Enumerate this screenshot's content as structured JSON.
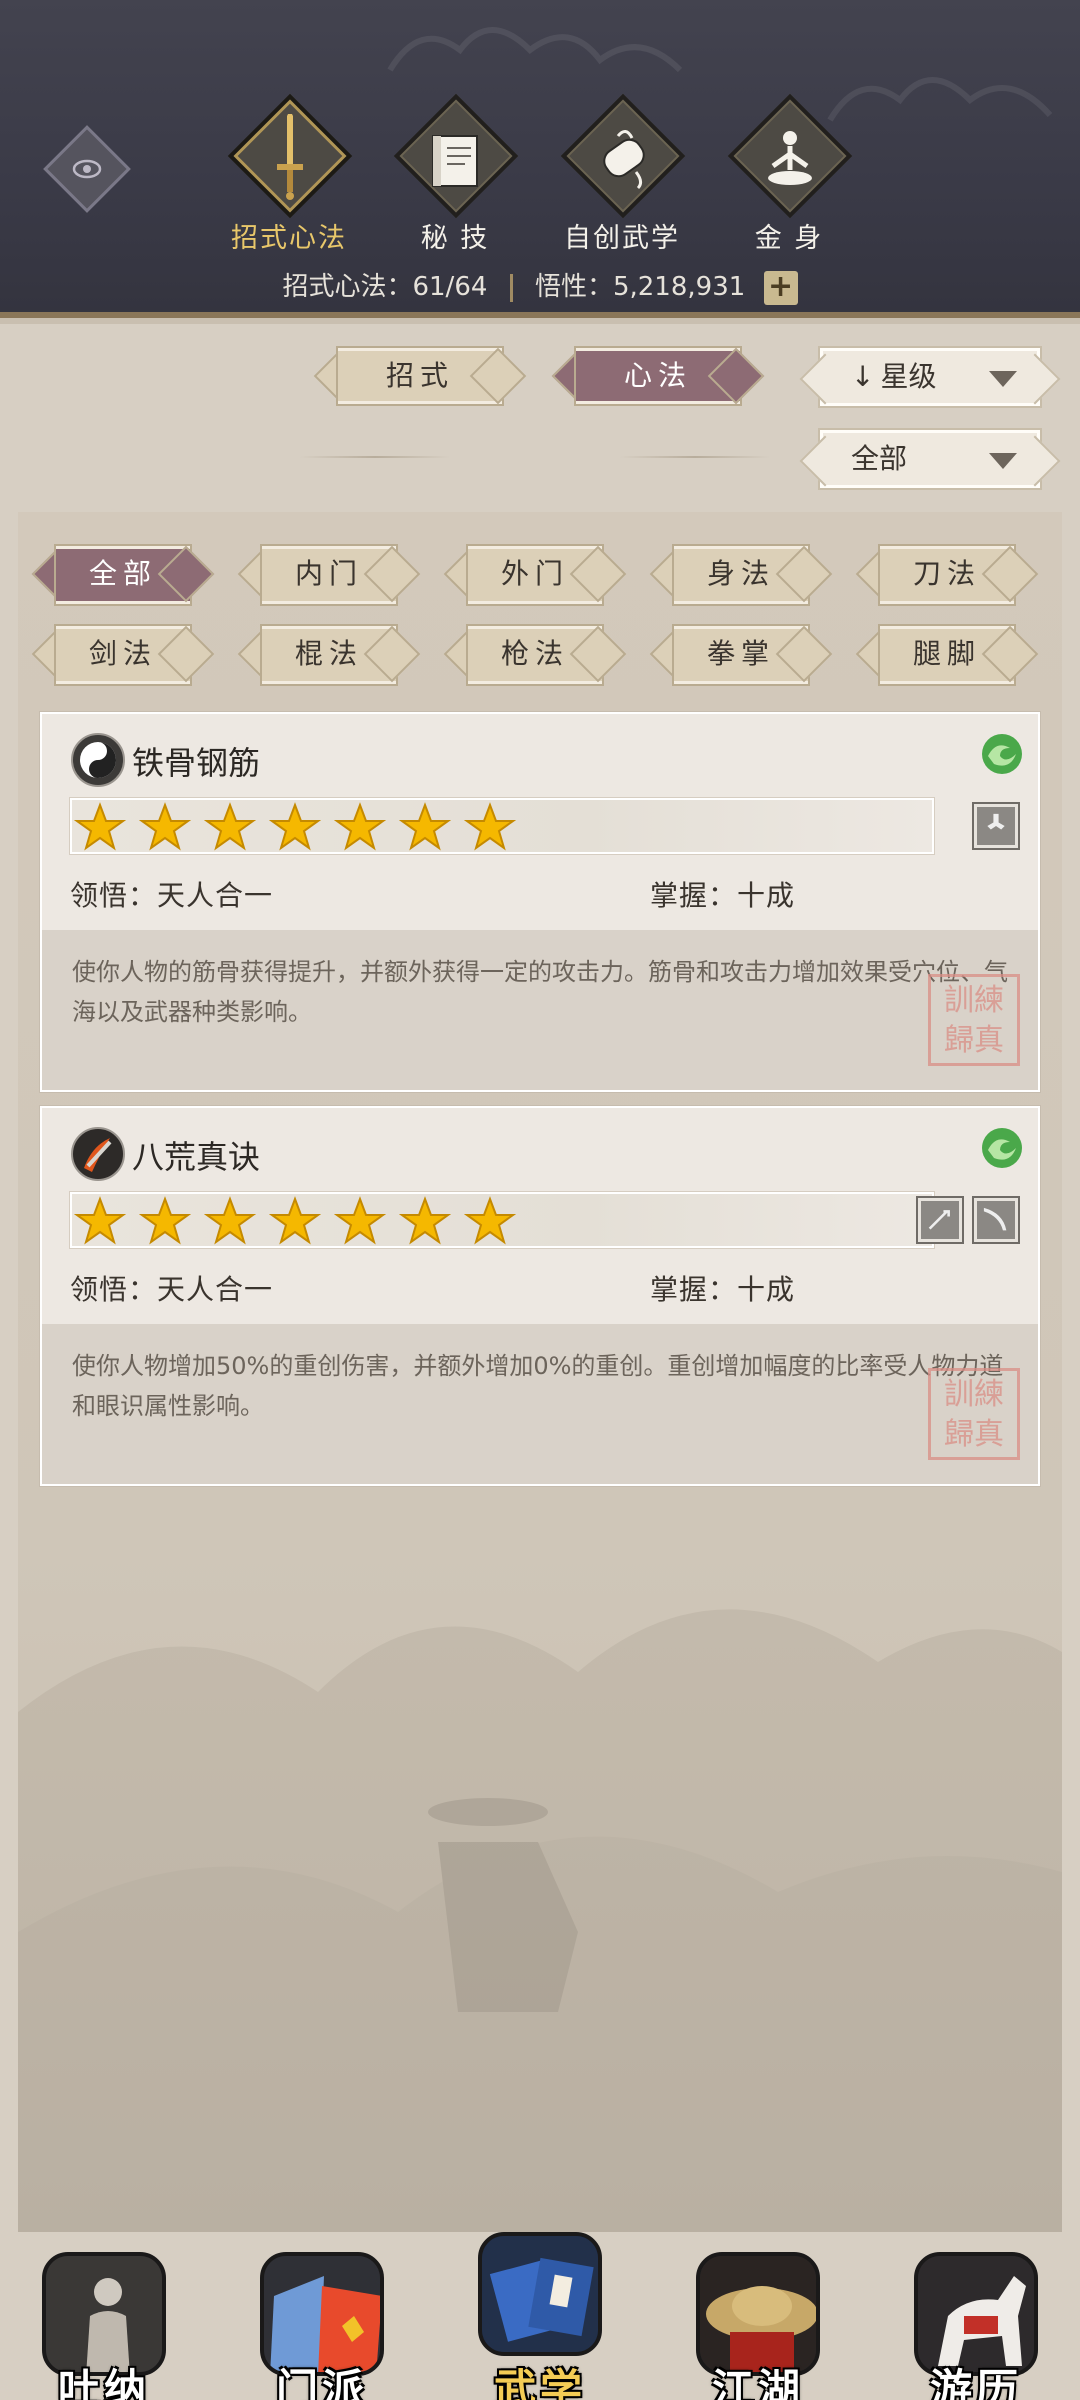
{
  "header": {
    "tabs": [
      {
        "label": "招式心法",
        "icon": "sword-icon",
        "active": true
      },
      {
        "label": "秘 技",
        "icon": "book-icon",
        "active": false
      },
      {
        "label": "自创武学",
        "icon": "scroll-icon",
        "active": false
      },
      {
        "label": "金 身",
        "icon": "meditation-icon",
        "active": false
      }
    ],
    "stats": {
      "skills_label": "招式心法：",
      "skills_value": "61/64",
      "insight_label": "悟性：",
      "insight_value": "5,218,931",
      "plus": "+"
    }
  },
  "controls": {
    "mode_tabs": [
      {
        "label": "招式",
        "active": false
      },
      {
        "label": "心法",
        "active": true
      }
    ],
    "sort_label": "星级",
    "sort_arrow": "↓",
    "filter_select": "全部"
  },
  "filters": [
    {
      "label": "全部",
      "active": true
    },
    {
      "label": "内门",
      "active": false
    },
    {
      "label": "外门",
      "active": false
    },
    {
      "label": "身法",
      "active": false
    },
    {
      "label": "刀法",
      "active": false
    },
    {
      "label": "剑法",
      "active": false
    },
    {
      "label": "棍法",
      "active": false
    },
    {
      "label": "枪法",
      "active": false
    },
    {
      "label": "拳掌",
      "active": false
    },
    {
      "label": "腿脚",
      "active": false
    }
  ],
  "skills": [
    {
      "name": "铁骨钢筋",
      "stars": 7,
      "comprehension_label": "领悟：",
      "comprehension": "天人合一",
      "mastery_label": "掌握：",
      "mastery": "十成",
      "description": "使你人物的筋骨获得提升，并额外获得一定的攻击力。筋骨和攻击力增加效果受穴位、气海以及武器种类影响。",
      "seal": "訓練\n歸真"
    },
    {
      "name": "八荒真诀",
      "stars": 7,
      "comprehension_label": "领悟：",
      "comprehension": "天人合一",
      "mastery_label": "掌握：",
      "mastery": "十成",
      "description": "使你人物增加50%的重创伤害，并额外增加0%的重创。重创增加幅度的比率受人物力道和眼识属性影响。",
      "seal": "訓練\n歸真"
    }
  ],
  "bottom_nav": [
    {
      "label": "吐纳",
      "active": false
    },
    {
      "label": "门派",
      "active": false
    },
    {
      "label": "武学",
      "active": true
    },
    {
      "label": "江湖",
      "active": false
    },
    {
      "label": "游历",
      "active": false
    }
  ],
  "colors": {
    "header_bg": "#3a3a47",
    "accent_gold": "#e8c76a",
    "active_pill": "#8d6b74",
    "panel_bg": "#d3c9bb",
    "seal_red": "#d98e86"
  }
}
